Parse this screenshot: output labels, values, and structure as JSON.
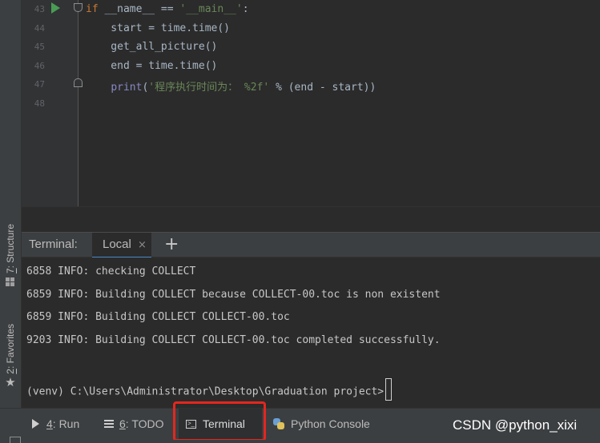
{
  "editor": {
    "lines": [
      {
        "no": "43",
        "parts": [
          {
            "t": "if",
            "c": "kw"
          },
          {
            "t": " __name__ == ",
            "c": ""
          },
          {
            "t": "'__main__'",
            "c": "str"
          },
          {
            "t": ":",
            "c": ""
          }
        ]
      },
      {
        "no": "44",
        "parts": [
          {
            "t": "    start = time.time()",
            "c": ""
          }
        ]
      },
      {
        "no": "45",
        "parts": [
          {
            "t": "    get_all_picture()",
            "c": ""
          }
        ]
      },
      {
        "no": "46",
        "parts": [
          {
            "t": "    end = time.time()",
            "c": ""
          }
        ]
      },
      {
        "no": "47",
        "parts": [
          {
            "t": "    ",
            "c": ""
          },
          {
            "t": "print",
            "c": "fn"
          },
          {
            "t": "(",
            "c": ""
          },
          {
            "t": "'程序执行时间为： %2f'",
            "c": "str"
          },
          {
            "t": " % (end - start))",
            "c": ""
          }
        ]
      },
      {
        "no": "48",
        "parts": []
      }
    ]
  },
  "left_strip": {
    "structure": {
      "mnemonic": "7",
      "label": ": Structure"
    },
    "favorites": {
      "mnemonic": "2",
      "label": ": Favorites"
    }
  },
  "terminal": {
    "title": "Terminal:",
    "tab_label": "Local",
    "close_glyph": "×",
    "add_glyph": "+",
    "lines": [
      "6858 INFO: checking COLLECT",
      "6859 INFO: Building COLLECT because COLLECT-00.toc is non existent",
      "6859 INFO: Building COLLECT COLLECT-00.toc",
      "9203 INFO: Building COLLECT COLLECT-00.toc completed successfully.",
      "",
      "(venv) C:\\Users\\Administrator\\Desktop\\Graduation project>"
    ]
  },
  "bottom_bar": {
    "run": {
      "mnemonic": "4",
      "label": ": Run"
    },
    "todo": {
      "mnemonic": "6",
      "label": ": TODO"
    },
    "terminal": {
      "label": "Terminal"
    },
    "python_console": {
      "label": "Python Console"
    }
  },
  "watermark": "CSDN @python_xixi",
  "colors": {
    "highlight_box": "#e3271f",
    "keyword": "#cc7832",
    "string": "#6a8759",
    "builtin": "#8888c6",
    "run_gutter": "#499c54"
  }
}
